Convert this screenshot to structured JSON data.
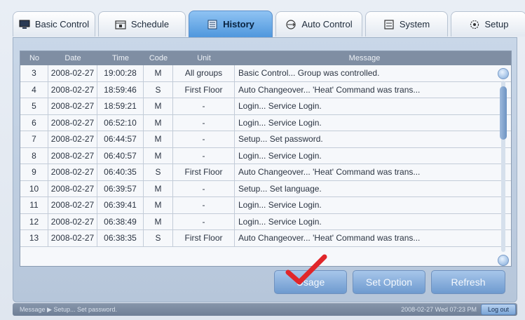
{
  "tabs": [
    {
      "label": "Basic Control",
      "icon": "monitor-icon"
    },
    {
      "label": "Schedule",
      "icon": "calendar-icon"
    },
    {
      "label": "History",
      "icon": "history-list-icon"
    },
    {
      "label": "Auto Control",
      "icon": "auto-control-icon"
    },
    {
      "label": "System",
      "icon": "system-icon"
    },
    {
      "label": "Setup",
      "icon": "gear-icon"
    }
  ],
  "active_tab": "History",
  "table": {
    "headers": [
      "No",
      "Date",
      "Time",
      "Code",
      "Unit",
      "Message"
    ],
    "rows": [
      {
        "no": "3",
        "date": "2008-02-27",
        "time": "19:00:28",
        "code": "M",
        "unit": "All groups",
        "message": "Basic Control... Group was controlled."
      },
      {
        "no": "4",
        "date": "2008-02-27",
        "time": "18:59:46",
        "code": "S",
        "unit": "First Floor",
        "message": "Auto Changeover... 'Heat' Command was trans..."
      },
      {
        "no": "5",
        "date": "2008-02-27",
        "time": "18:59:21",
        "code": "M",
        "unit": "-",
        "message": "Login... Service Login."
      },
      {
        "no": "6",
        "date": "2008-02-27",
        "time": "06:52:10",
        "code": "M",
        "unit": "-",
        "message": "Login... Service Login."
      },
      {
        "no": "7",
        "date": "2008-02-27",
        "time": "06:44:57",
        "code": "M",
        "unit": "-",
        "message": "Setup... Set password."
      },
      {
        "no": "8",
        "date": "2008-02-27",
        "time": "06:40:57",
        "code": "M",
        "unit": "-",
        "message": "Login... Service Login."
      },
      {
        "no": "9",
        "date": "2008-02-27",
        "time": "06:40:35",
        "code": "S",
        "unit": "First Floor",
        "message": "Auto Changeover... 'Heat' Command was trans..."
      },
      {
        "no": "10",
        "date": "2008-02-27",
        "time": "06:39:57",
        "code": "M",
        "unit": "-",
        "message": "Setup... Set language."
      },
      {
        "no": "11",
        "date": "2008-02-27",
        "time": "06:39:41",
        "code": "M",
        "unit": "-",
        "message": "Login... Service Login."
      },
      {
        "no": "12",
        "date": "2008-02-27",
        "time": "06:38:49",
        "code": "M",
        "unit": "-",
        "message": "Login... Service Login."
      },
      {
        "no": "13",
        "date": "2008-02-27",
        "time": "06:38:35",
        "code": "S",
        "unit": "First Floor",
        "message": "Auto Changeover... 'Heat' Command was trans..."
      }
    ]
  },
  "buttons": {
    "usage": "Usage",
    "set_option": "Set Option",
    "refresh": "Refresh"
  },
  "status_bar": {
    "message": "Message ▶ Setup... Set password.",
    "timestamp": "2008-02-27 Wed 07:23 PM",
    "logout": "Log out"
  },
  "colors": {
    "active_tab": "#5fa3e3",
    "check_mark": "#e0262a",
    "button": "#7fa6d6"
  }
}
